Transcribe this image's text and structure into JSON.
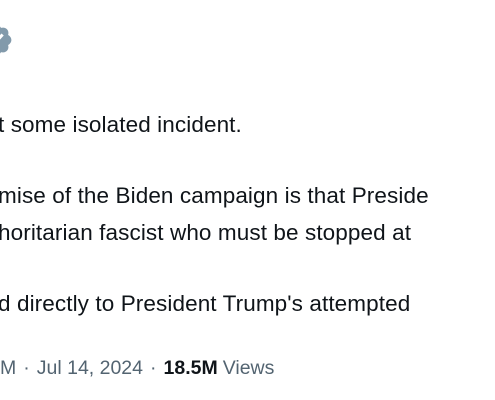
{
  "post": {
    "lines": [
      "t some isolated incident.",
      "mise of the Biden campaign is that Preside",
      "horitarian fascist who must be stopped at",
      "d directly to President Trump's attempted"
    ]
  },
  "meta": {
    "time_fragment": "M",
    "separator": "·",
    "date": "Jul 14, 2024",
    "views_count": "18.5M",
    "views_label": "Views"
  },
  "colors": {
    "text": "#0f1419",
    "secondary": "#536471",
    "badge": "#829aab"
  },
  "icons": {
    "badge": "verified-badge-icon"
  }
}
